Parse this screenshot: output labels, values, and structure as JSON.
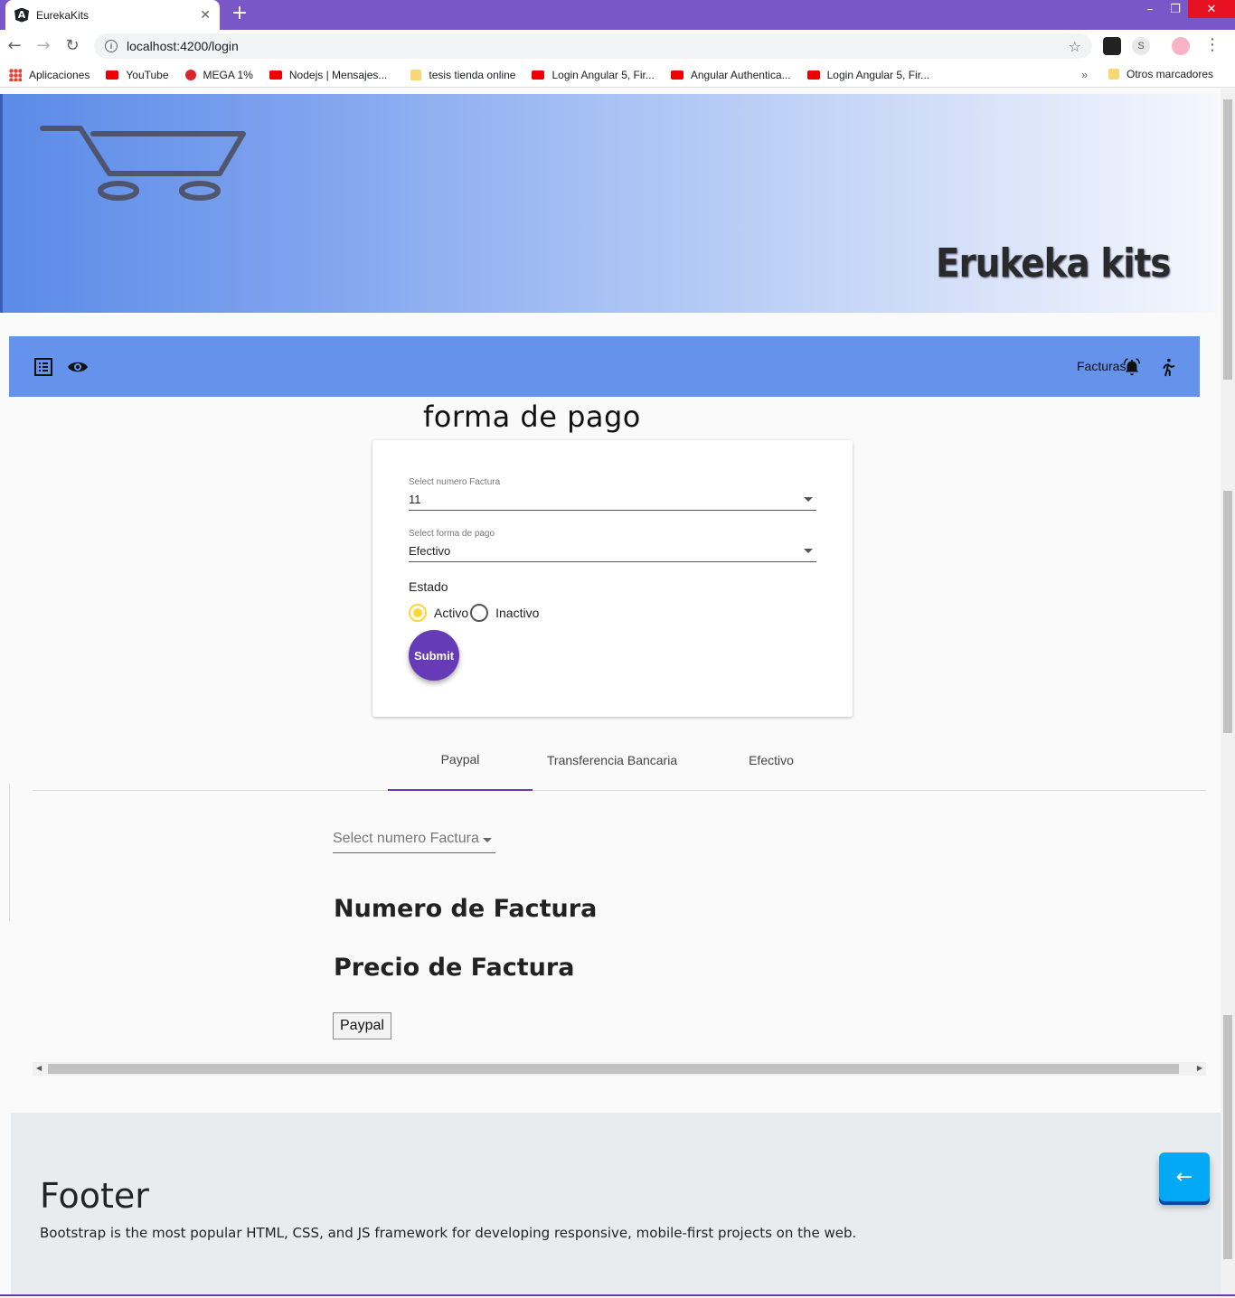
{
  "browser": {
    "tab_title": "EurekaKits",
    "tab_favicon": "A",
    "url": "localhost:4200/login",
    "bookmarks": [
      {
        "label": "Aplicaciones",
        "icon": "apps-icon"
      },
      {
        "label": "YouTube",
        "icon": "youtube-icon"
      },
      {
        "label": "MEGA 1%",
        "icon": "mega-icon"
      },
      {
        "label": "Nodejs | Mensajes...",
        "icon": "youtube-icon"
      },
      {
        "label": "tesis tienda online",
        "icon": "folder-icon"
      },
      {
        "label": "Login Angular 5, Fir...",
        "icon": "youtube-icon"
      },
      {
        "label": "Angular Authentica...",
        "icon": "youtube-icon"
      },
      {
        "label": "Login Angular 5, Fir...",
        "icon": "youtube-icon"
      }
    ],
    "bookmarks_more": "»",
    "other_bookmarks": "Otros marcadores"
  },
  "banner": {
    "brand": "Erukeka kits"
  },
  "navbar": {
    "facturas_label": "Facturas"
  },
  "form": {
    "title": "forma de pago",
    "factura_label": "Select numero Factura",
    "factura_value": "11",
    "pago_label": "Select forma de pago",
    "pago_value": "Efectivo",
    "estado_label": "Estado",
    "radio_activo": "Activo",
    "radio_inactivo": "Inactivo",
    "selected_estado": "Activo",
    "submit_label": "Submit"
  },
  "tabs": {
    "items": [
      "Paypal",
      "Transferencia Bancaria",
      "Efectivo"
    ],
    "active": "Paypal"
  },
  "paypal_panel": {
    "select_placeholder": "Select numero Factura",
    "numero_heading": "Numero de Factura",
    "precio_heading": "Precio de Factura",
    "paypal_button": "Paypal"
  },
  "footer": {
    "title": "Footer",
    "text": "Bootstrap is the most popular HTML, CSS, and JS framework for developing responsive, mobile-first projects on the web."
  },
  "colors": {
    "browser_frame": "#7957c9",
    "navbar": "#6592ea",
    "accent_purple": "#673ab7",
    "radio_yellow": "#fdd835",
    "back_button": "#03a9f4"
  }
}
